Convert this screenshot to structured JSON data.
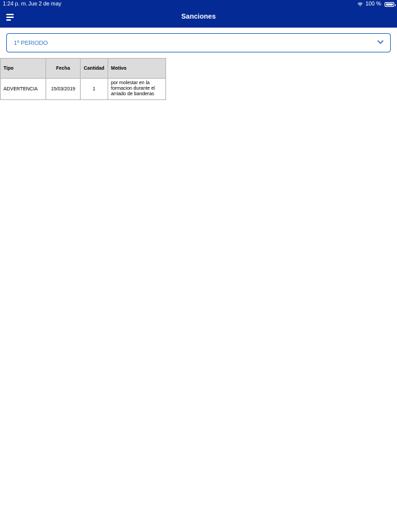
{
  "status_bar": {
    "time": "1:24 p. m.",
    "date": "Jue 2 de may",
    "battery": "100 %"
  },
  "header": {
    "title": "Sanciones"
  },
  "period_select": {
    "value": "1º PERIODO"
  },
  "table": {
    "headers": [
      "Tipo",
      "Fecha",
      "Cantidad",
      "Motivo"
    ],
    "rows": [
      {
        "tipo": "ADVERTENCIA",
        "fecha": "15/03/2019",
        "cantidad": "1",
        "motivo": "por molestar en la formacion durante el arriado de banderas"
      }
    ]
  },
  "colors": {
    "header_bg": "#032a95",
    "accent": "#2f72c6",
    "table_header_bg": "#dcdcdc"
  },
  "icons": {
    "menu": "hamburger-menu-icon",
    "dropdown": "chevron-down-icon",
    "wifi": "wifi-icon",
    "battery": "battery-icon"
  }
}
